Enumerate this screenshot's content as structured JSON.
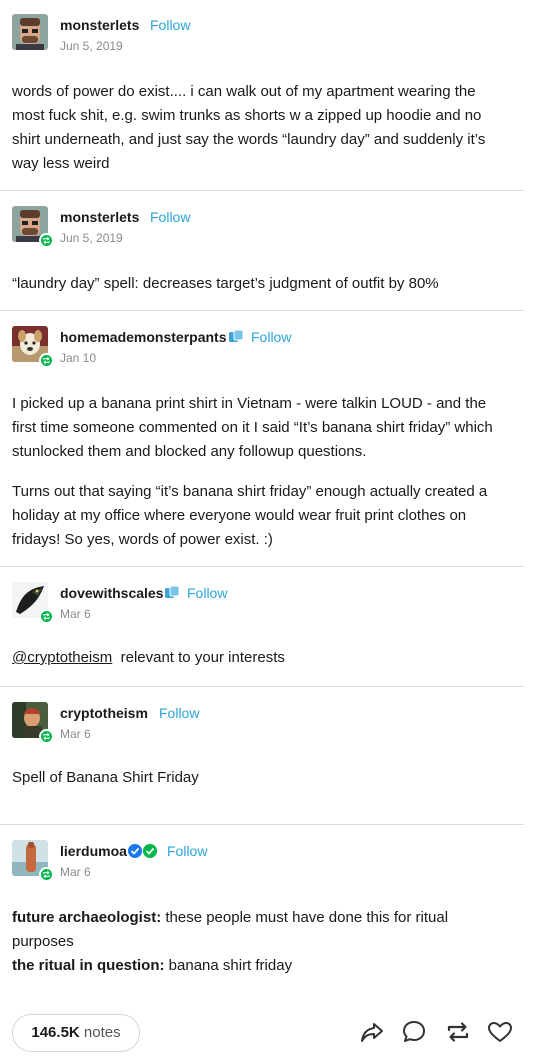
{
  "posts": [
    {
      "username": "monsterlets",
      "follow": "Follow",
      "date": "Jun 5, 2019",
      "body": "words of power do exist.... i can walk out of my apartment wearing the most fuck shit, e.g. swim trunks as shorts w a zipped up hoodie and no shirt underneath, and just say the words “laundry day” and suddenly it’s way less weird"
    },
    {
      "username": "monsterlets",
      "follow": "Follow",
      "date": "Jun 5, 2019",
      "body": "“laundry day” spell: decreases target’s judgment of outfit by 80%"
    },
    {
      "username": "homemademonsterpants",
      "follow": "Follow",
      "date": "Jan 10",
      "body1": "I picked up a banana print shirt in Vietnam - were talkin LOUD - and the first time someone commented on it I said “It’s banana shirt friday” which stunlocked them and blocked any followup questions.",
      "body2": "Turns out that saying “it’s banana shirt friday” enough actually created a holiday at my office where everyone would wear fruit print clothes on fridays! So yes, words of power exist. :)"
    },
    {
      "username": "dovewithscales",
      "follow": "Follow",
      "date": "Mar 6",
      "mention": "@cryptotheism",
      "body": "relevant to your interests"
    },
    {
      "username": "cryptotheism",
      "follow": "Follow",
      "date": "Mar 6",
      "body": "Spell of Banana Shirt Friday"
    },
    {
      "username": "lierdumoa",
      "follow": "Follow",
      "date": "Mar 6",
      "line1_bold": "future archaeologist:",
      "line1_rest": " these people must have done this for ritual purposes",
      "line2_bold": "the ritual in question:",
      "line2_rest": " banana shirt friday"
    }
  ],
  "footer": {
    "notes_count": "146.5K",
    "notes_label": "notes"
  },
  "icons": {
    "share": "share-arrow-icon",
    "reply": "reply-bubble-icon",
    "reblog": "reblog-icon",
    "like": "heart-icon",
    "badge": "reblog-badge-icon",
    "verified": "verified-check-icon",
    "side": "side-blog-icon"
  },
  "colors": {
    "follow": "#2aa6d9",
    "reblog_badge": "#00b84a",
    "verified": "#1877f2",
    "verified_alt": "#00b84a",
    "side_icon": "#3ea3d6"
  }
}
